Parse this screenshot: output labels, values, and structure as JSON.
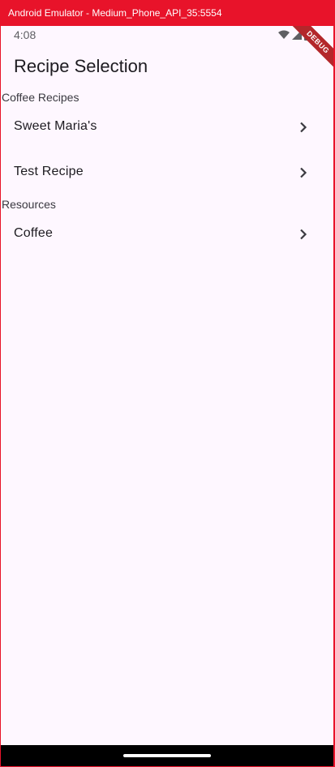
{
  "window": {
    "title": "Android Emulator - Medium_Phone_API_35:5554"
  },
  "status_bar": {
    "time": "4:08",
    "icons": [
      "wifi-icon",
      "signal-icon",
      "battery-icon"
    ]
  },
  "debug_banner": {
    "label": "DEBUG"
  },
  "app_bar": {
    "title": "Recipe Selection"
  },
  "sections": [
    {
      "header": "Coffee Recipes",
      "items": [
        {
          "label": "Sweet Maria's",
          "icon": "chevron-right-icon"
        },
        {
          "label": "Test Recipe",
          "icon": "chevron-right-icon"
        }
      ]
    },
    {
      "header": "Resources",
      "items": [
        {
          "label": "Coffee",
          "icon": "chevron-right-icon"
        }
      ]
    }
  ],
  "colors": {
    "frame": "#e8132a",
    "background": "#fef7ff",
    "text": "#1d1b20",
    "nav_bar": "#000000"
  }
}
